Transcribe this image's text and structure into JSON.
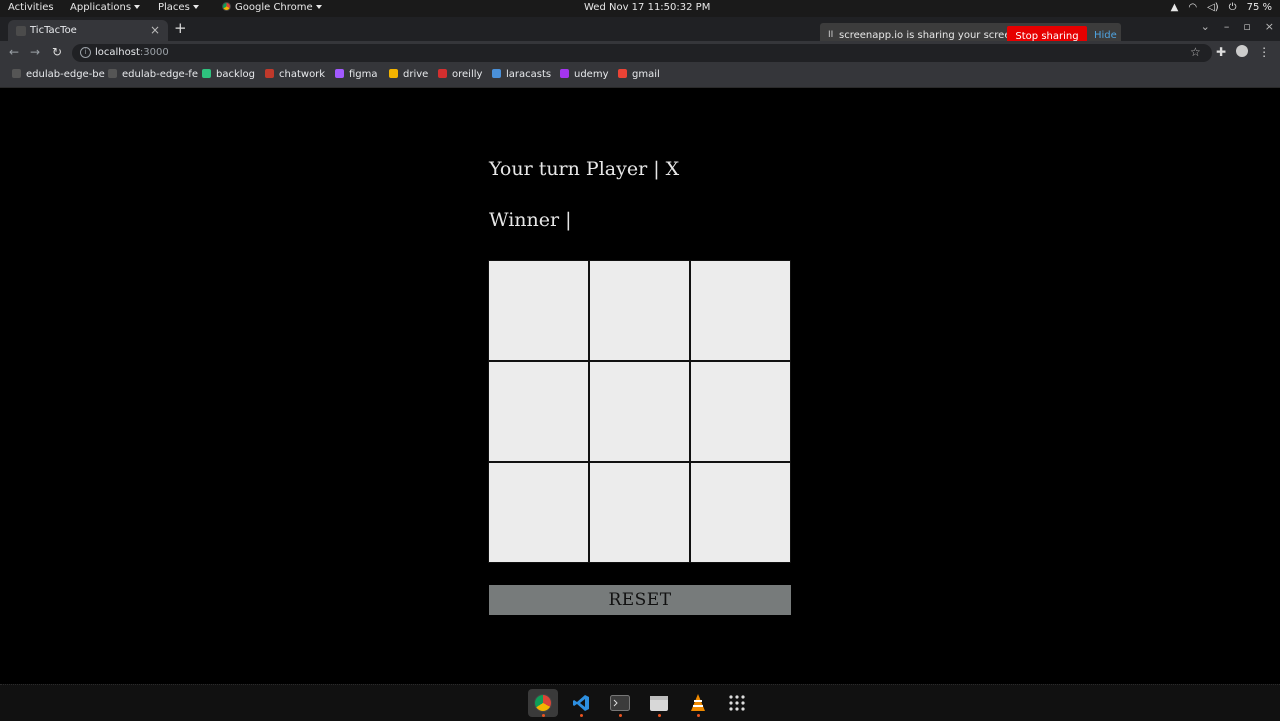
{
  "os": {
    "activities": "Activities",
    "applications": "Applications",
    "places": "Places",
    "app_name": "Google Chrome",
    "clock": "Wed Nov 17  11:50:32 PM",
    "battery": "75 %"
  },
  "browser": {
    "tab_title": "TicTacToe",
    "url_host": "localhost",
    "url_port": ":3000",
    "bookmarks": [
      "edulab-edge-be",
      "edulab-edge-fe",
      "backlog",
      "chatwork",
      "figma",
      "drive",
      "oreilly",
      "laracasts",
      "udemy",
      "gmail"
    ],
    "bookmark_colors": [
      "#555555",
      "#555555",
      "#2ec27e",
      "#c0392b",
      "#a259ff",
      "#f4b400",
      "#d32f2f",
      "#4a90d9",
      "#a435f0",
      "#ea4335"
    ]
  },
  "share_banner": {
    "message": "screenapp.io is sharing your screen.",
    "stop_label": "Stop sharing",
    "hide_label": "Hide"
  },
  "game": {
    "turn_text": "Your turn Player | X",
    "winner_text": "Winner |",
    "cells": [
      "",
      "",
      "",
      "",
      "",
      "",
      "",
      "",
      ""
    ],
    "reset_label": "RESET"
  },
  "dock": {
    "apps": [
      "chrome-icon",
      "vscode-icon",
      "terminal-icon",
      "files-icon",
      "vlc-icon",
      "app-grid-icon"
    ]
  }
}
